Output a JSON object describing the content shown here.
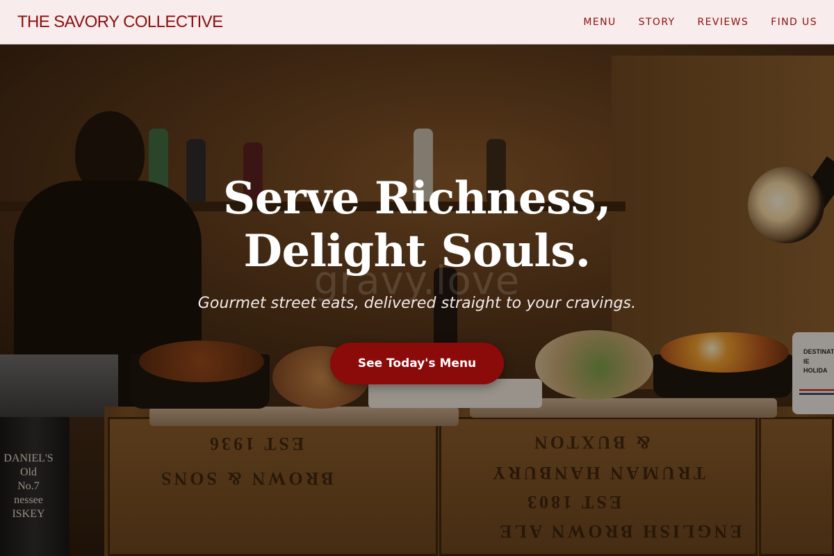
{
  "header": {
    "brand": "THE SAVORY COLLECTIVE",
    "nav": [
      {
        "label": "MENU"
      },
      {
        "label": "STORY"
      },
      {
        "label": "REVIEWS"
      },
      {
        "label": "FIND US"
      }
    ]
  },
  "hero": {
    "headline": "Serve Richness, Delight Souls.",
    "watermark": "gravy.love",
    "tagline": "Gourmet street eats, delivered straight to your cravings.",
    "cta_label": "See Today's Menu"
  },
  "background_photo": {
    "crate_texts": [
      "EST 1936",
      "BROWN & SONS",
      "EST 1803",
      "TRUMAN HANBURY",
      "& BUXTON",
      "ENGLISH BROWN ALE"
    ],
    "tin_label": "DANIEL'S\nOld\nNo.7\nnessee\nISKEY",
    "mug_label": "DESTINAT\nIE\nHOLIDA"
  },
  "colors": {
    "accent": "#8b0e0e",
    "header_bg": "#f8ecec",
    "cta_bg": "#8b0a0a"
  }
}
